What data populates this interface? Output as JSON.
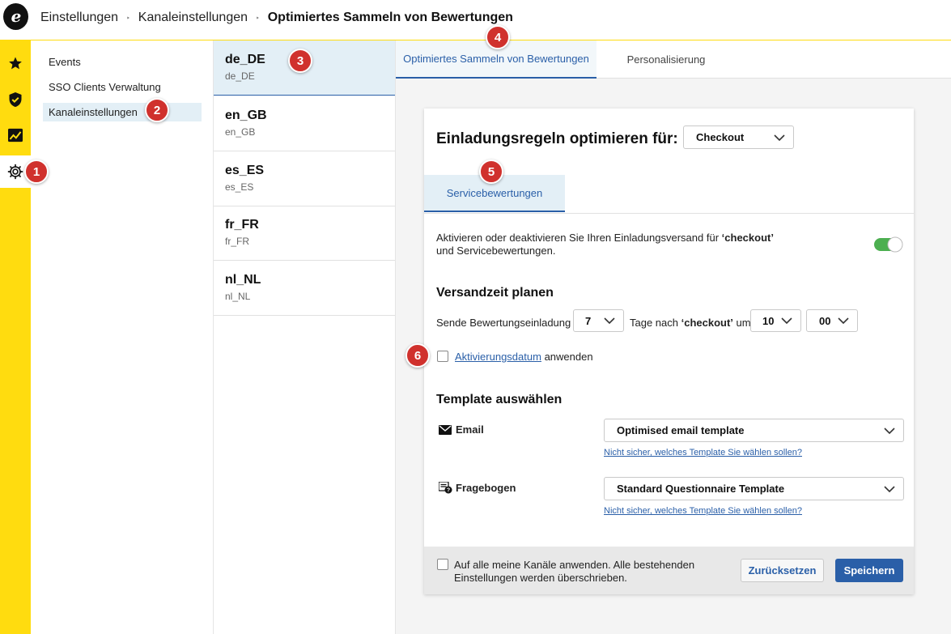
{
  "breadcrumb": {
    "items": [
      "Einstellungen",
      "Kanaleinstellungen",
      "Optimiertes Sammeln von Bewertungen"
    ],
    "separator": "‣"
  },
  "rail": {
    "items": [
      "star-icon",
      "shield-check-icon",
      "chart-icon",
      "gear-icon"
    ],
    "active": "gear-icon"
  },
  "subnav": {
    "items": [
      "Events",
      "SSO Clients Verwaltung",
      "Kanaleinstellungen"
    ],
    "active": "Kanaleinstellungen"
  },
  "locales": [
    {
      "code": "de_DE",
      "sub": "de_DE"
    },
    {
      "code": "en_GB",
      "sub": "en_GB"
    },
    {
      "code": "es_ES",
      "sub": "es_ES"
    },
    {
      "code": "fr_FR",
      "sub": "fr_FR"
    },
    {
      "code": "nl_NL",
      "sub": "nl_NL"
    }
  ],
  "tabs": [
    "Optimiertes Sammeln von Bewertungen",
    "Personalisierung"
  ],
  "card": {
    "title": "Einladungsregeln optimieren für:",
    "optimize_for": "Checkout",
    "subtab": "Servicebewertungen",
    "toggle_text_1": "Aktivieren oder deaktivieren Sie Ihren Einladungsversand für ",
    "toggle_text_bold": "‘checkout’",
    "toggle_text_2": " und Servicebewertungen.",
    "toggle_on": true,
    "schedule_title": "Versandzeit planen",
    "send_label": "Sende Bewertungseinladung",
    "days_value": "7",
    "days_after": "Tage nach ",
    "days_after_bold": "‘checkout’",
    "at_label": " um",
    "hour_value": "10",
    "minute_value": "00",
    "activation_link": "Aktivierungsdatum",
    "activation_after": " anwenden",
    "template_title": "Template auswählen",
    "email_label": "Email",
    "email_template": "Optimised email template",
    "questionnaire_label": "Fragebogen",
    "questionnaire_template": "Standard Questionnaire Template",
    "help_link": "Nicht sicher, welches Template Sie wählen sollen?",
    "apply_all": "Auf alle meine Kanäle anwenden. Alle bestehenden Einstellungen werden überschrieben.",
    "reset": "Zurücksetzen",
    "save": "Speichern"
  },
  "badges": [
    "1",
    "2",
    "3",
    "4",
    "5",
    "6"
  ],
  "colors": {
    "brand_yellow": "#FFDC0F",
    "accent_blue": "#2a5fa8",
    "badge_red": "#d0312d",
    "toggle_green": "#4caf50"
  }
}
